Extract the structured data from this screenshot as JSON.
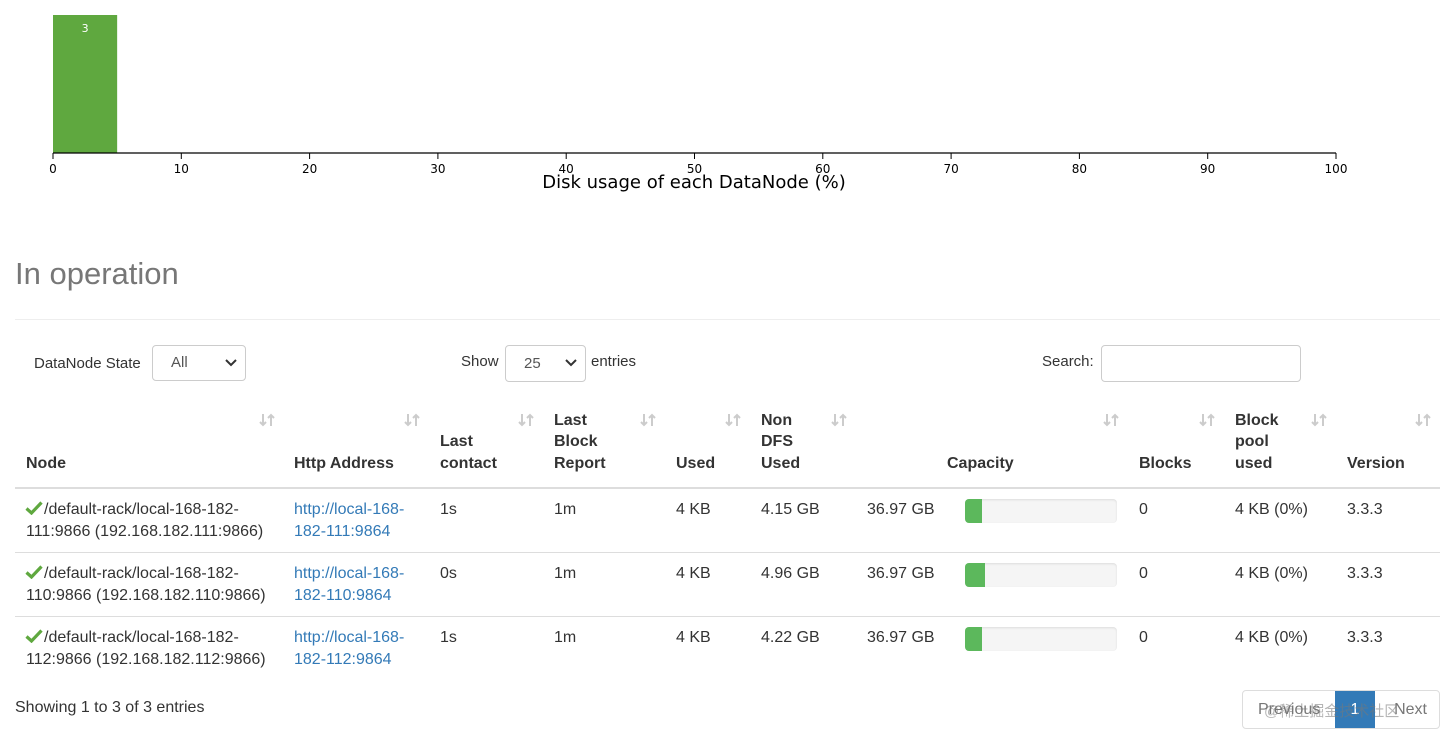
{
  "chart_data": {
    "type": "bar",
    "xlabel": "Disk usage of each DataNode (%)",
    "xlim": [
      0,
      100
    ],
    "x_ticks": [
      "0",
      "10",
      "20",
      "30",
      "40",
      "50",
      "60",
      "70",
      "80",
      "90",
      "100"
    ],
    "bins": [
      {
        "x0": 0,
        "x1": 5,
        "count": 3
      }
    ],
    "bar_color": "#5fa83f"
  },
  "section": {
    "title": "In operation"
  },
  "controls": {
    "state_label": "DataNode State",
    "state_value": "All",
    "show_label": "Show",
    "show_value": "25",
    "entries_label": "entries",
    "search_label": "Search:",
    "search_value": ""
  },
  "table": {
    "headers": {
      "node": "Node",
      "http": "Http Address",
      "last_contact": "Last contact",
      "last_block": "Last Block Report",
      "used": "Used",
      "non_dfs": "Non DFS Used",
      "capacity": "Capacity",
      "blocks": "Blocks",
      "pool": "Block pool used",
      "version": "Version"
    },
    "rows": [
      {
        "node_line1": "/default-rack/local-168-182-",
        "node_line2": "111:9866 (192.168.182.111:9866)",
        "http_line1": "http://local-168-",
        "http_line2": "182-111:9864",
        "last_contact": "1s",
        "last_block": "1m",
        "used": "4 KB",
        "non_dfs": "4.15 GB",
        "capacity": "36.97 GB",
        "capacity_used_fraction": 0.11,
        "blocks": "0",
        "pool": "4 KB (0%)",
        "version": "3.3.3"
      },
      {
        "node_line1": "/default-rack/local-168-182-",
        "node_line2": "110:9866 (192.168.182.110:9866)",
        "http_line1": "http://local-168-",
        "http_line2": "182-110:9864",
        "last_contact": "0s",
        "last_block": "1m",
        "used": "4 KB",
        "non_dfs": "4.96 GB",
        "capacity": "36.97 GB",
        "capacity_used_fraction": 0.13,
        "blocks": "0",
        "pool": "4 KB (0%)",
        "version": "3.3.3"
      },
      {
        "node_line1": "/default-rack/local-168-182-",
        "node_line2": "112:9866 (192.168.182.112:9866)",
        "http_line1": "http://local-168-",
        "http_line2": "182-112:9864",
        "last_contact": "1s",
        "last_block": "1m",
        "used": "4 KB",
        "non_dfs": "4.22 GB",
        "capacity": "36.97 GB",
        "capacity_used_fraction": 0.11,
        "blocks": "0",
        "pool": "4 KB (0%)",
        "version": "3.3.3"
      }
    ]
  },
  "footer": {
    "info": "Showing 1 to 3 of 3 entries",
    "previous": "Previous",
    "current_page": "1",
    "next": "Next",
    "watermark": "@稀土掘金技术社区"
  },
  "colors": {
    "link": "#337ab7",
    "progress": "#5cb85c",
    "check": "#5fa83f",
    "page_active": "#337ab7"
  }
}
